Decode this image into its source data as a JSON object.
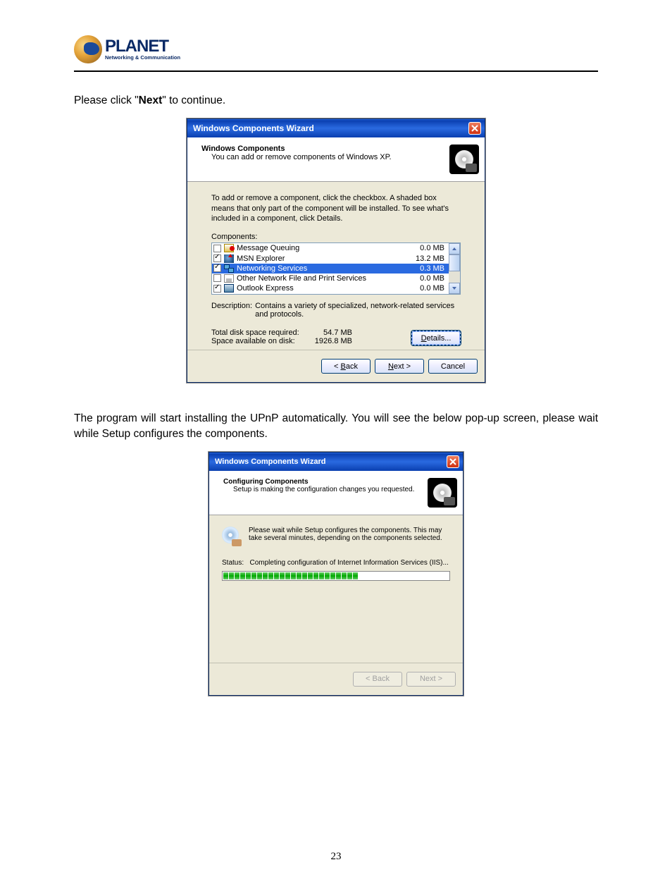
{
  "logo": {
    "brand": "PLANET",
    "tagline": "Networking & Communication"
  },
  "text": {
    "para1_pre": "Please click \"",
    "para1_bold": "Next",
    "para1_post": "\" to continue.",
    "para2": "The program will start installing the UPnP automatically. You will see the below pop-up screen, please wait while Setup configures the components.",
    "page_num": "23"
  },
  "dialog1": {
    "title": "Windows Components Wizard",
    "header_title": "Windows Components",
    "header_sub": "You can add or remove components of Windows XP.",
    "instruction": "To add or remove a component, click the checkbox. A shaded box means that only part of the component will be installed. To see what's included in a component, click Details.",
    "components_label_pre": "C",
    "components_label_post": "omponents:",
    "rows": [
      {
        "label": "Message Queuing",
        "size": "0.0 MB",
        "checked": false,
        "icon": "env",
        "sel": false
      },
      {
        "label": "MSN Explorer",
        "size": "13.2 MB",
        "checked": true,
        "icon": "msn",
        "sel": false
      },
      {
        "label": "Networking Services",
        "size": "0.3 MB",
        "checked": true,
        "icon": "net",
        "sel": true
      },
      {
        "label": "Other Network File and Print Services",
        "size": "0.0 MB",
        "checked": false,
        "icon": "prt",
        "sel": false
      },
      {
        "label": "Outlook Express",
        "size": "0.0 MB",
        "checked": true,
        "icon": "oe",
        "sel": false
      }
    ],
    "desc_label": "Description:",
    "desc_text": "Contains a variety of specialized, network-related services and protocols.",
    "total_label": "Total disk space required:",
    "total_value": "54.7 MB",
    "avail_label": "Space available on disk:",
    "avail_value": "1926.8 MB",
    "details_btn_pre": "D",
    "details_btn_post": "etails...",
    "back_btn_pre": "< ",
    "back_btn_u": "B",
    "back_btn_post": "ack",
    "next_btn_u": "N",
    "next_btn_post": "ext >",
    "cancel_btn": "Cancel"
  },
  "dialog2": {
    "title": "Windows Components Wizard",
    "header_title": "Configuring Components",
    "header_sub": "Setup is making the configuration changes you requested.",
    "message": "Please wait while Setup configures the components. This may take several minutes, depending on the components selected.",
    "status_label": "Status:",
    "status_text": "Completing configuration of Internet Information Services (IIS)...",
    "progress_segments": 24,
    "back_btn": "< Back",
    "next_btn": "Next >"
  }
}
